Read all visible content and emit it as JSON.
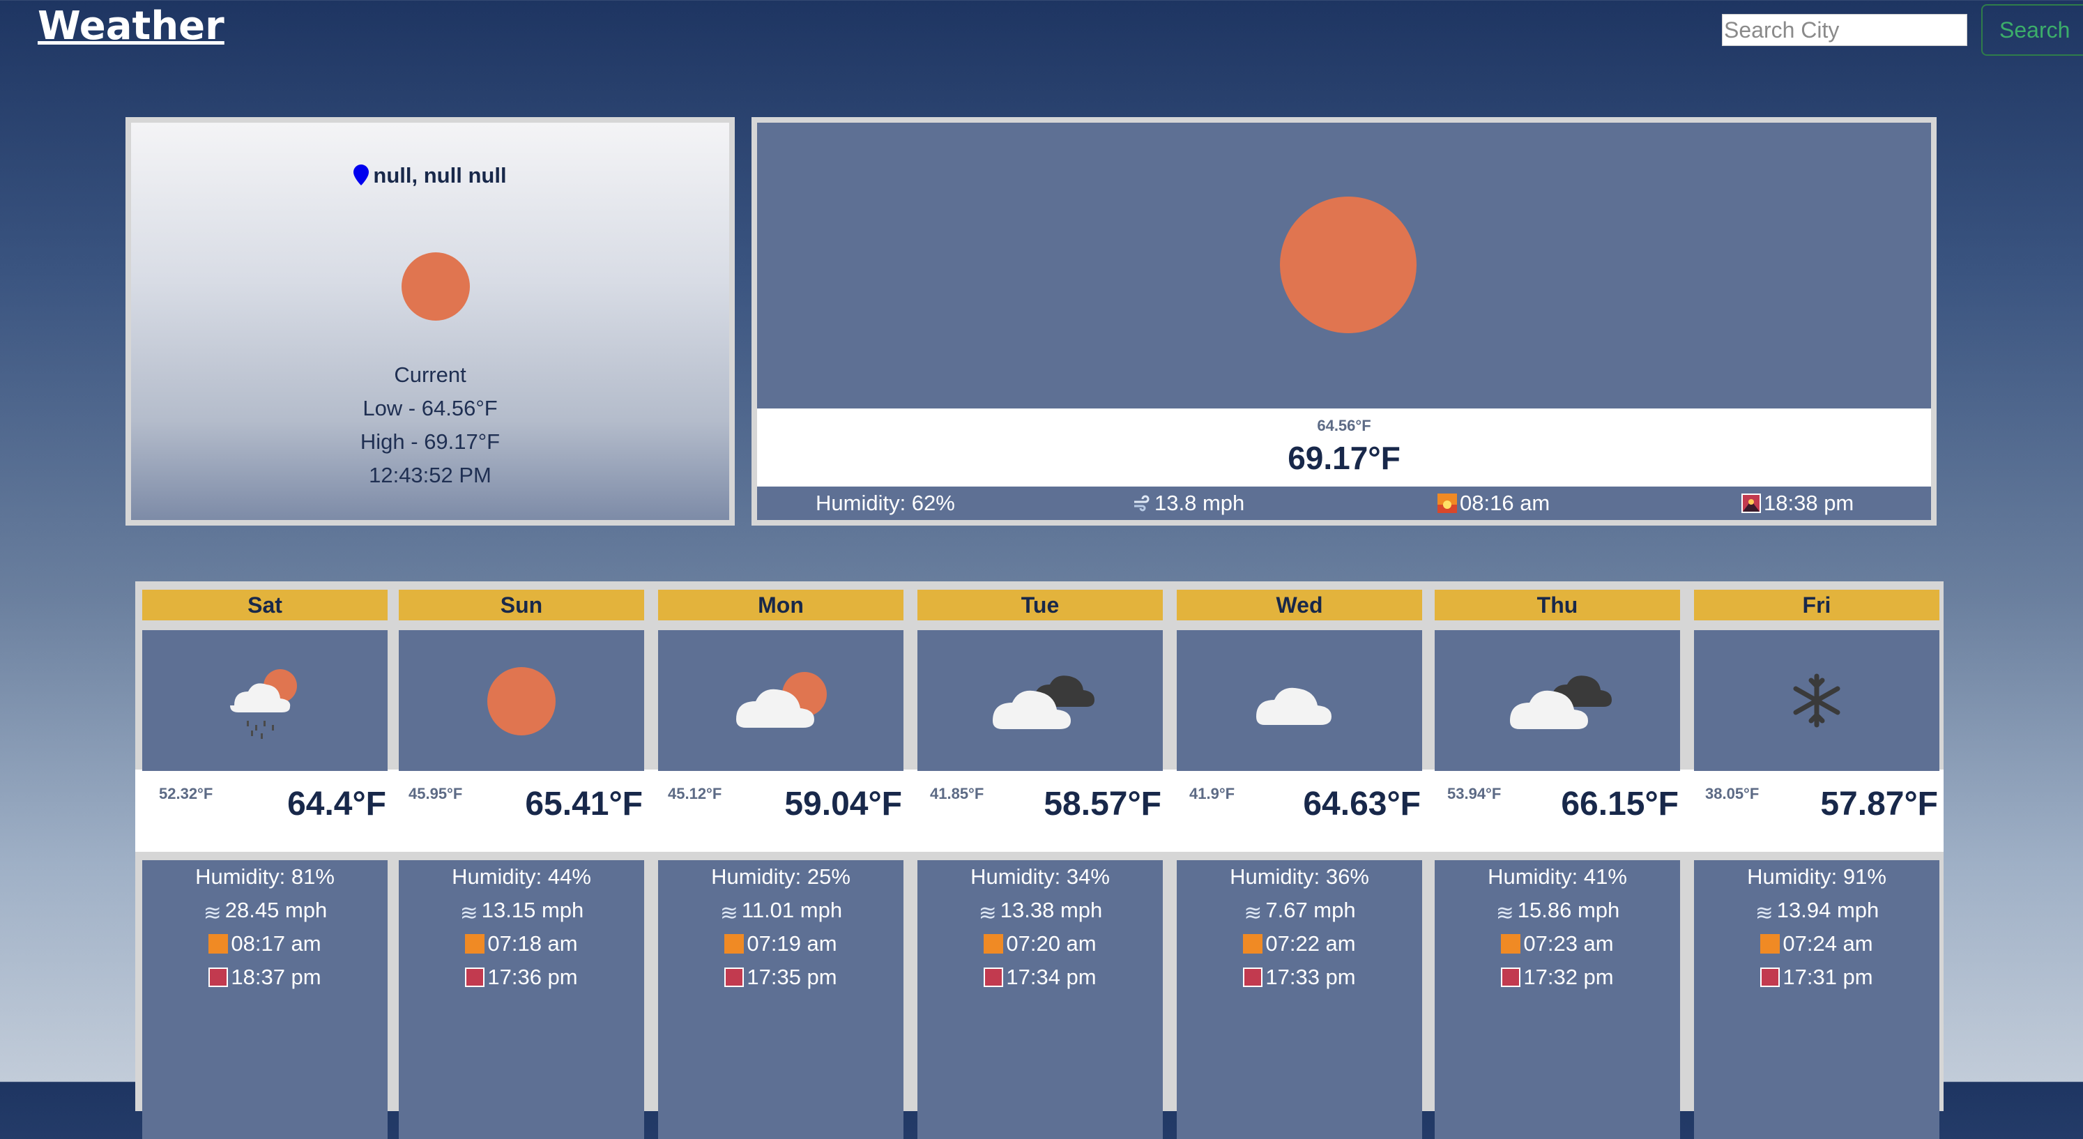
{
  "header": {
    "title": "Weather",
    "search_placeholder": "Search City",
    "search_button": "Search"
  },
  "current": {
    "location": "null, null null",
    "label": "Current",
    "low": "Low - 64.56°F",
    "high": "High - 69.17°F",
    "time": "12:43:52 PM",
    "icon": "sun-icon"
  },
  "today": {
    "icon": "sun-icon",
    "low": "64.56°F",
    "high": "69.17°F",
    "humidity": "Humidity: 62%",
    "wind": "13.8 mph",
    "sunrise": "08:16 am",
    "sunset": "18:38 pm"
  },
  "colors": {
    "sun": "#e07550",
    "header_yellow": "#e3b33c",
    "card_blue": "#5e7094"
  },
  "forecast": [
    {
      "day": "Sat",
      "icon": "rain-sun-icon",
      "low": "52.32°F",
      "high": "64.4°F",
      "humidity": "Humidity: 81%",
      "wind": "28.45 mph",
      "sunrise": "08:17 am",
      "sunset": "18:37 pm"
    },
    {
      "day": "Sun",
      "icon": "sun-icon",
      "low": "45.95°F",
      "high": "65.41°F",
      "humidity": "Humidity: 44%",
      "wind": "13.15 mph",
      "sunrise": "07:18 am",
      "sunset": "17:36 pm"
    },
    {
      "day": "Mon",
      "icon": "cloud-sun-icon",
      "low": "45.12°F",
      "high": "59.04°F",
      "humidity": "Humidity: 25%",
      "wind": "11.01 mph",
      "sunrise": "07:19 am",
      "sunset": "17:35 pm"
    },
    {
      "day": "Tue",
      "icon": "broken-clouds-icon",
      "low": "41.85°F",
      "high": "58.57°F",
      "humidity": "Humidity: 34%",
      "wind": "13.38 mph",
      "sunrise": "07:20 am",
      "sunset": "17:34 pm"
    },
    {
      "day": "Wed",
      "icon": "cloud-icon",
      "low": "41.9°F",
      "high": "64.63°F",
      "humidity": "Humidity: 36%",
      "wind": "7.67 mph",
      "sunrise": "07:22 am",
      "sunset": "17:33 pm"
    },
    {
      "day": "Thu",
      "icon": "broken-clouds-icon",
      "low": "53.94°F",
      "high": "66.15°F",
      "humidity": "Humidity: 41%",
      "wind": "15.86 mph",
      "sunrise": "07:23 am",
      "sunset": "17:32 pm"
    },
    {
      "day": "Fri",
      "icon": "snow-icon",
      "low": "38.05°F",
      "high": "57.87°F",
      "humidity": "Humidity: 91%",
      "wind": "13.94 mph",
      "sunrise": "07:24 am",
      "sunset": "17:31 pm"
    }
  ]
}
